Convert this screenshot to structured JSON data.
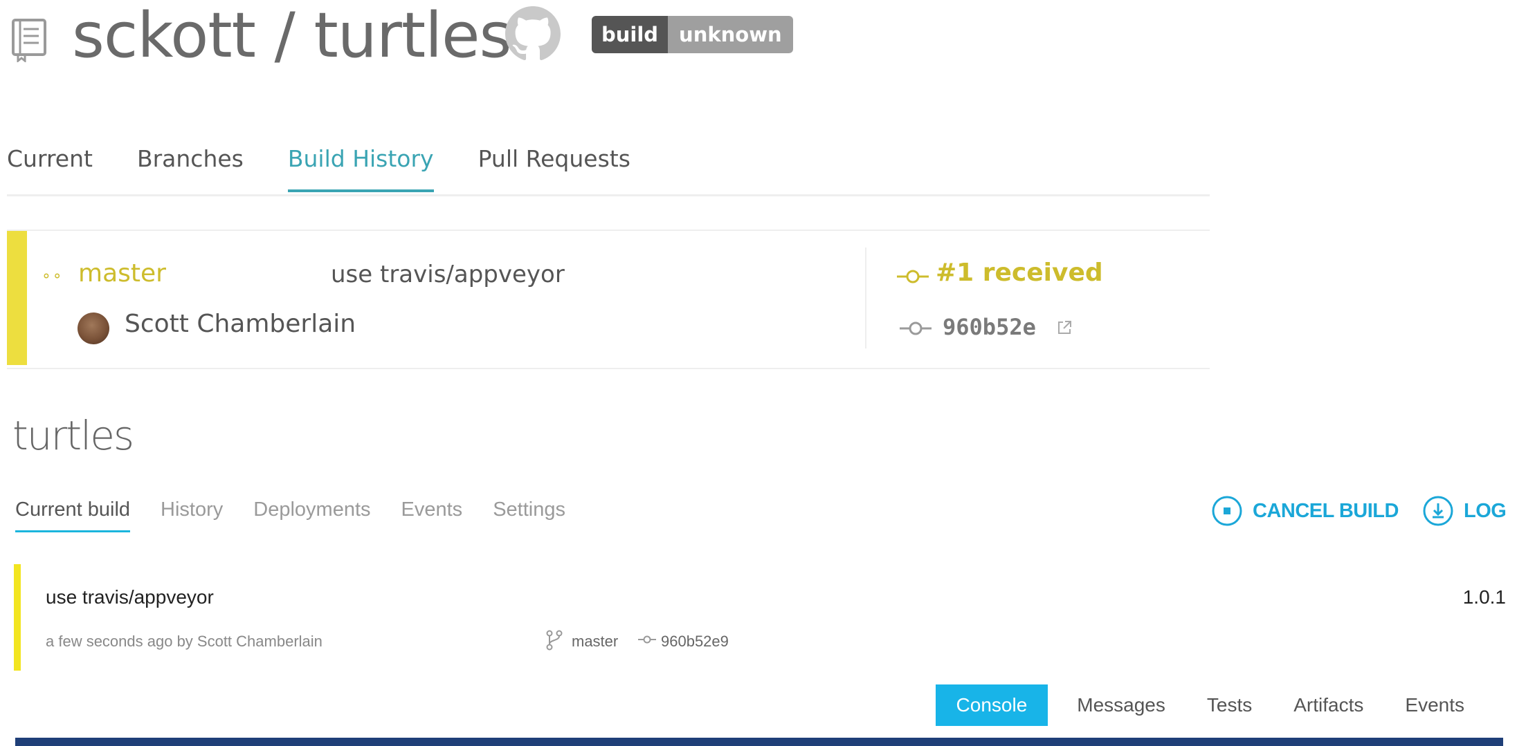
{
  "travis": {
    "header": {
      "owner": "sckott",
      "separator": " / ",
      "repo": "turtles",
      "repo_icon": "repo-book-icon",
      "github_icon": "github-octocat-icon",
      "badge": {
        "left": "build",
        "right": "unknown"
      }
    },
    "tabs": [
      {
        "label": "Current"
      },
      {
        "label": "Branches"
      },
      {
        "label": "Build History",
        "active": true
      },
      {
        "label": "Pull Requests"
      }
    ],
    "build": {
      "status_color": "#edde3f",
      "branch": "master",
      "message": "use travis/appveyor",
      "author": "Scott Chamberlain",
      "number_status": "#1 received",
      "commit": "960b52e"
    }
  },
  "appveyor": {
    "project_title": "turtles",
    "tabs": [
      {
        "label": "Current build",
        "active": true
      },
      {
        "label": "History"
      },
      {
        "label": "Deployments"
      },
      {
        "label": "Events"
      },
      {
        "label": "Settings"
      }
    ],
    "actions": {
      "cancel": "CANCEL BUILD",
      "log": "LOG"
    },
    "build": {
      "message": "use travis/appveyor",
      "version": "1.0.1",
      "meta": "a few seconds ago by Scott Chamberlain",
      "branch": "master",
      "commit": "960b52e9"
    },
    "sub_tabs": [
      {
        "label": "Console",
        "active": true
      },
      {
        "label": "Messages"
      },
      {
        "label": "Tests"
      },
      {
        "label": "Artifacts"
      },
      {
        "label": "Events"
      }
    ],
    "accent_color": "#18b4e8"
  }
}
